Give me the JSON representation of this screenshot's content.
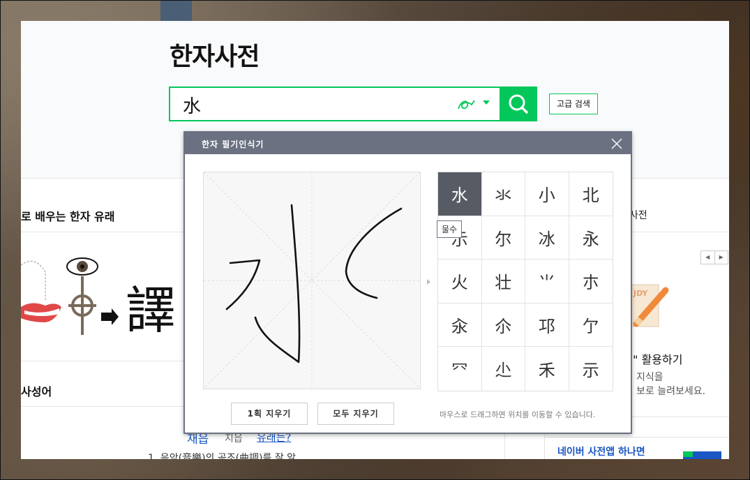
{
  "page_title": "한자사전",
  "search": {
    "value": "水"
  },
  "advanced_search_label": "고급 검색",
  "sections": {
    "learn_title": "로 배우는 한자 유래",
    "idiom_title": "사성어",
    "right_title": "사전",
    "promo_title": ".\" 활용하기",
    "promo_line1": "지식을",
    "promo_line2": "보로 늘려보세요.",
    "app_banner": "네이버 사전앱 하나면"
  },
  "word": {
    "main": "재읍",
    "sub": "지읍",
    "link": "유래는?",
    "definition": "1. 음악(音樂)의 곡조(曲調)를 잘 알"
  },
  "dialog": {
    "title": "한자 필기인식기",
    "candidates": [
      "水",
      "氺",
      "小",
      "北",
      "示",
      "尔",
      "冰",
      "永",
      "火",
      "壮",
      "⺌",
      "朩",
      "汆",
      "尒",
      "邛",
      "亇",
      "⺳",
      "尐",
      "禾",
      "示"
    ],
    "selected_index": 0,
    "tooltip": "물수",
    "clear_one_label": "1획 지우기",
    "clear_all_label": "모두 지우기",
    "hint": "마우스로 드래그하면 위치를 이동할 수 있습니다."
  },
  "colors": {
    "brand_green": "#03c75a",
    "dialog_header": "#6b7180",
    "link_blue": "#1a56c4"
  }
}
